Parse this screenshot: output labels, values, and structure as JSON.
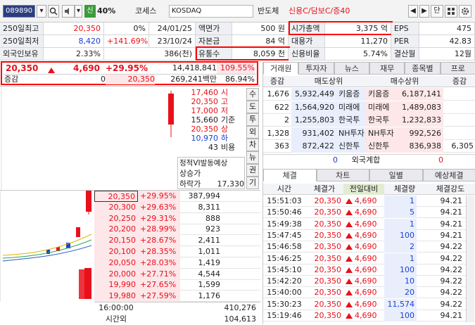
{
  "toolbar": {
    "code": "089890",
    "badge": "신",
    "margin": "40%",
    "name": "코세스",
    "market": "KOSDAQ",
    "sector": "반도체",
    "credit": "신용C/담보C/증40",
    "single_label": "단"
  },
  "info": {
    "row1": {
      "label": "250일최고",
      "price": "20,350",
      "pct": "0%",
      "date": "24/01/25",
      "k1": "액면가",
      "v1": "500 원",
      "k2": "시가총액",
      "v2": "3,375 억",
      "k3": "EPS",
      "v3": "475"
    },
    "row2": {
      "label": "250일최저",
      "price": "8,420",
      "pct": "+141.69%",
      "date": "23/10/24",
      "k1": "자본금",
      "v1": "84 억",
      "k2": "대용가",
      "v2": "11,270",
      "k3": "PER",
      "v3": "42.83"
    },
    "row3": {
      "label": "외국인보유",
      "price": "2.33%",
      "pct": "386(천)",
      "k1": "유통수",
      "v1": "8,059 천",
      "k2": "신용비율",
      "v2": "5.74%",
      "k3": "결산월",
      "v3": "12월"
    }
  },
  "quote": {
    "price": "20,350",
    "change": "4,690",
    "rate": "+29.95%",
    "volume": "14,418,841",
    "vol_ratio": "109.55%",
    "margin_label": "증감",
    "margin_value": "0",
    "margin_price": "20,350",
    "amount": "269,241백만",
    "amount_pct": "86.94%"
  },
  "summary": [
    {
      "value": "17,460",
      "label": "시",
      "color": "red"
    },
    {
      "value": "20,350",
      "label": "고",
      "color": "red"
    },
    {
      "value": "17,000",
      "label": "저",
      "color": "red"
    },
    {
      "value": "15,660",
      "label": "기준",
      "color": "black"
    },
    {
      "value": "20,350",
      "label": "상",
      "color": "red"
    },
    {
      "value": "10,970",
      "label": "하",
      "color": "blue"
    },
    {
      "value": "43",
      "label": "비용",
      "color": "black"
    }
  ],
  "vi": {
    "title": "정적VI발동예상",
    "up_label": "상승가",
    "down_label": "하락가",
    "down_value": "17,330"
  },
  "side_buttons": [
    "수",
    "도",
    "투",
    "외",
    "차",
    "뉴",
    "권",
    "기"
  ],
  "orderbook": [
    {
      "price": "20,350",
      "rate": "+29.95%",
      "qty": "387,994"
    },
    {
      "price": "20,300",
      "rate": "+29.63%",
      "qty": "8,311"
    },
    {
      "price": "20,250",
      "rate": "+29.31%",
      "qty": "888"
    },
    {
      "price": "20,200",
      "rate": "+28.99%",
      "qty": "923"
    },
    {
      "price": "20,150",
      "rate": "+28.67%",
      "qty": "2,411"
    },
    {
      "price": "20,100",
      "rate": "+28.35%",
      "qty": "1,011"
    },
    {
      "price": "20,050",
      "rate": "+28.03%",
      "qty": "1,419"
    },
    {
      "price": "20,000",
      "rate": "+27.71%",
      "qty": "4,544"
    },
    {
      "price": "19,990",
      "rate": "+27.65%",
      "qty": "1,599"
    },
    {
      "price": "19,980",
      "rate": "+27.59%",
      "qty": "1,176"
    }
  ],
  "orderbook_footer": {
    "time": "16:00:00",
    "total": "410,276",
    "label": "시간외",
    "ext": "104,613"
  },
  "right_tabs": [
    "거래원",
    "투자자",
    "뉴스",
    "재무",
    "종목별",
    "프로"
  ],
  "broker_header": {
    "delta": "증감",
    "sell": "매도상위",
    "buy": "매수상위",
    "delta2": "증감"
  },
  "brokers": [
    {
      "d1": "1,676",
      "sq": "5,932,449",
      "sn": "키움증",
      "bn": "키움증",
      "bq": "6,187,141",
      "d2": ""
    },
    {
      "d1": "622",
      "sq": "1,564,920",
      "sn": "미래에",
      "bn": "미래에",
      "bq": "1,489,083",
      "d2": ""
    },
    {
      "d1": "2",
      "sq": "1,255,803",
      "sn": "한국투",
      "bn": "한국투",
      "bq": "1,232,833",
      "d2": ""
    },
    {
      "d1": "1,328",
      "sq": "931,402",
      "sn": "NH투자",
      "bn": "NH투자",
      "bq": "992,526",
      "d2": ""
    },
    {
      "d1": "363",
      "sq": "872,422",
      "sn": "신한투",
      "bn": "신한투",
      "bq": "836,938",
      "d2": "6,305"
    }
  ],
  "foreign_row": {
    "sell": "0",
    "label": "외국계합",
    "buy": "0"
  },
  "trade_tabs": [
    "체결",
    "차트",
    "일별",
    "예상체결"
  ],
  "trade_header": {
    "time": "시간",
    "price": "체결가",
    "change": "전일대비",
    "qty": "체결량",
    "strength": "체결강도"
  },
  "trades": [
    {
      "time": "15:51:03",
      "price": "20,350",
      "change": "4,690",
      "qty": "1",
      "strength": "94.21"
    },
    {
      "time": "15:50:46",
      "price": "20,350",
      "change": "4,690",
      "qty": "5",
      "strength": "94.21"
    },
    {
      "time": "15:49:38",
      "price": "20,350",
      "change": "4,690",
      "qty": "1",
      "strength": "94.21"
    },
    {
      "time": "15:47:45",
      "price": "20,350",
      "change": "4,690",
      "qty": "100",
      "strength": "94.21"
    },
    {
      "time": "15:46:58",
      "price": "20,350",
      "change": "4,690",
      "qty": "2",
      "strength": "94.22"
    },
    {
      "time": "15:46:25",
      "price": "20,350",
      "change": "4,690",
      "qty": "1",
      "strength": "94.22"
    },
    {
      "time": "15:45:10",
      "price": "20,350",
      "change": "4,690",
      "qty": "100",
      "strength": "94.22"
    },
    {
      "time": "15:42:20",
      "price": "20,350",
      "change": "4,690",
      "qty": "10",
      "strength": "94.22"
    },
    {
      "time": "15:40:00",
      "price": "20,350",
      "change": "4,690",
      "qty": "20",
      "strength": "94.22"
    },
    {
      "time": "15:30:23",
      "price": "20,350",
      "change": "4,690",
      "qty": "11,574",
      "strength": "94.22"
    },
    {
      "time": "15:19:46",
      "price": "20,350",
      "change": "4,690",
      "qty": "100",
      "strength": "94.21"
    }
  ],
  "colors": {
    "up": "#e8101a",
    "down": "#1a3fd4",
    "highlight": "#ff0000"
  }
}
